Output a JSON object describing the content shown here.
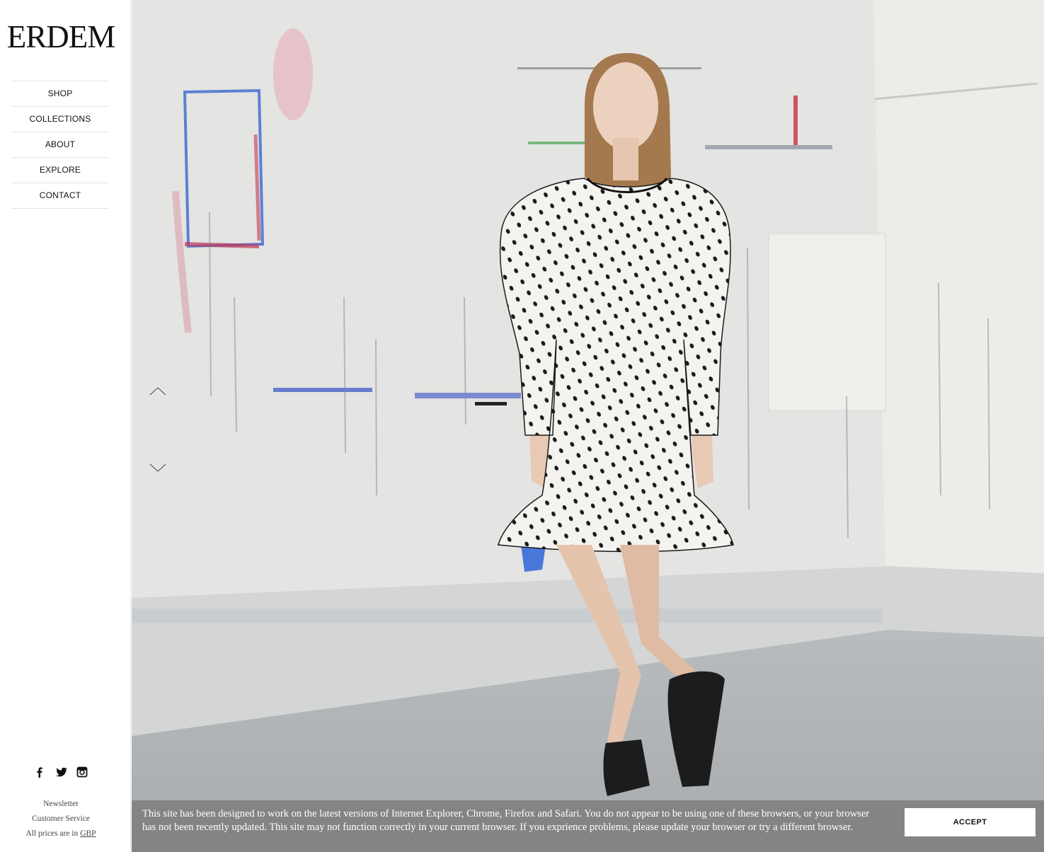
{
  "brand": {
    "logo_text": "ERDEM"
  },
  "nav": {
    "items": [
      {
        "label": "SHOP"
      },
      {
        "label": "COLLECTIONS"
      },
      {
        "label": "ABOUT"
      },
      {
        "label": "EXPLORE"
      },
      {
        "label": "CONTACT"
      }
    ]
  },
  "social": {
    "icons": [
      "facebook-icon",
      "twitter-icon",
      "instagram-icon"
    ]
  },
  "footer": {
    "newsletter": "Newsletter",
    "customer_service": "Customer Service",
    "prices_prefix": "All prices are in",
    "currency": "GBP"
  },
  "hero": {
    "image": "model-polka-dot-dress",
    "controls": [
      "chevron-up-icon",
      "chevron-down-icon"
    ]
  },
  "banner": {
    "message": "This site has been designed to work on the latest versions of Internet Explorer, Chrome, Firefox and Safari. You do not appear to be using one of these browsers, or your browser has not been recently updated. This site may not function correctly in your current browser. If you exprience problems, please update your browser or try a different browser.",
    "accept_label": "ACCEPT"
  },
  "colors": {
    "banner_bg": "#808080",
    "text": "#111111",
    "background": "#ffffff"
  }
}
